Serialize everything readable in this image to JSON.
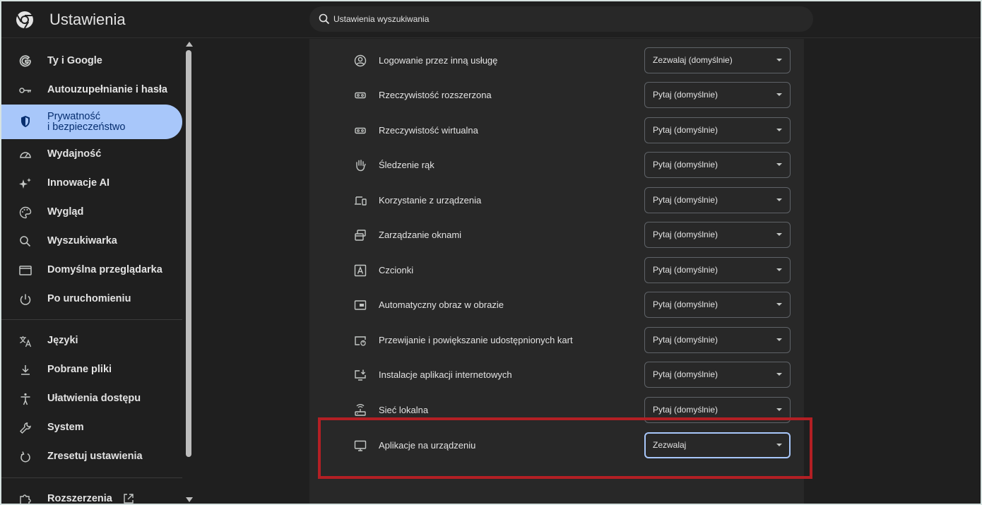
{
  "app": {
    "title": "Ustawienia",
    "search_placeholder": "Ustawienia wyszukiwania"
  },
  "sidebar": {
    "items": [
      {
        "label": "Ty i Google",
        "icon": "google-g-icon"
      },
      {
        "label": "Autouzupełnianie i hasła",
        "icon": "key-icon"
      },
      {
        "label_line1": "Prywatność",
        "label_line2": "i bezpieczeństwo",
        "icon": "shield-icon",
        "active": true
      },
      {
        "label": "Wydajność",
        "icon": "speedometer-icon"
      },
      {
        "label": "Innowacje AI",
        "icon": "sparkle-icon"
      },
      {
        "label": "Wygląd",
        "icon": "palette-icon"
      },
      {
        "label": "Wyszukiwarka",
        "icon": "search-icon"
      },
      {
        "label": "Domyślna przeglądarka",
        "icon": "browser-window-icon"
      },
      {
        "label": "Po uruchomieniu",
        "icon": "power-icon"
      },
      {
        "label": "Języki",
        "icon": "translate-icon"
      },
      {
        "label": "Pobrane pliki",
        "icon": "download-icon"
      },
      {
        "label": "Ułatwienia dostępu",
        "icon": "accessibility-icon"
      },
      {
        "label": "System",
        "icon": "wrench-icon"
      },
      {
        "label": "Zresetuj ustawienia",
        "icon": "reset-icon"
      },
      {
        "label": "Rozszerzenia",
        "icon": "extension-icon"
      }
    ]
  },
  "permissions": [
    {
      "label": "Logowanie przez inną usługę",
      "value": "Zezwalaj (domyślnie)",
      "icon": "account-circle-icon"
    },
    {
      "label": "Rzeczywistość rozszerzona",
      "value": "Pytaj (domyślnie)",
      "icon": "vr-headset-icon"
    },
    {
      "label": "Rzeczywistość wirtualna",
      "value": "Pytaj (domyślnie)",
      "icon": "vr-headset-icon"
    },
    {
      "label": "Śledzenie rąk",
      "value": "Pytaj (domyślnie)",
      "icon": "hand-icon"
    },
    {
      "label": "Korzystanie z urządzenia",
      "value": "Pytaj (domyślnie)",
      "icon": "devices-icon"
    },
    {
      "label": "Zarządzanie oknami",
      "value": "Pytaj (domyślnie)",
      "icon": "window-management-icon"
    },
    {
      "label": "Czcionki",
      "value": "Pytaj (domyślnie)",
      "icon": "font-icon"
    },
    {
      "label": "Automatyczny obraz w obrazie",
      "value": "Pytaj (domyślnie)",
      "icon": "picture-in-picture-icon"
    },
    {
      "label": "Przewijanie i powiększanie udostępnionych kart",
      "value": "Pytaj (domyślnie)",
      "icon": "shared-tab-icon"
    },
    {
      "label": "Instalacje aplikacji internetowych",
      "value": "Pytaj (domyślnie)",
      "icon": "install-desktop-icon"
    },
    {
      "label": "Sieć lokalna",
      "value": "Pytaj (domyślnie)",
      "icon": "router-icon"
    },
    {
      "label": "Aplikacje na urządzeniu",
      "value": "Zezwalaj",
      "icon": "monitor-icon"
    }
  ],
  "colors": {
    "accent": "#a8c7fa",
    "highlight": "#b31f24",
    "background": "#1f1f1f",
    "card": "#282828"
  }
}
